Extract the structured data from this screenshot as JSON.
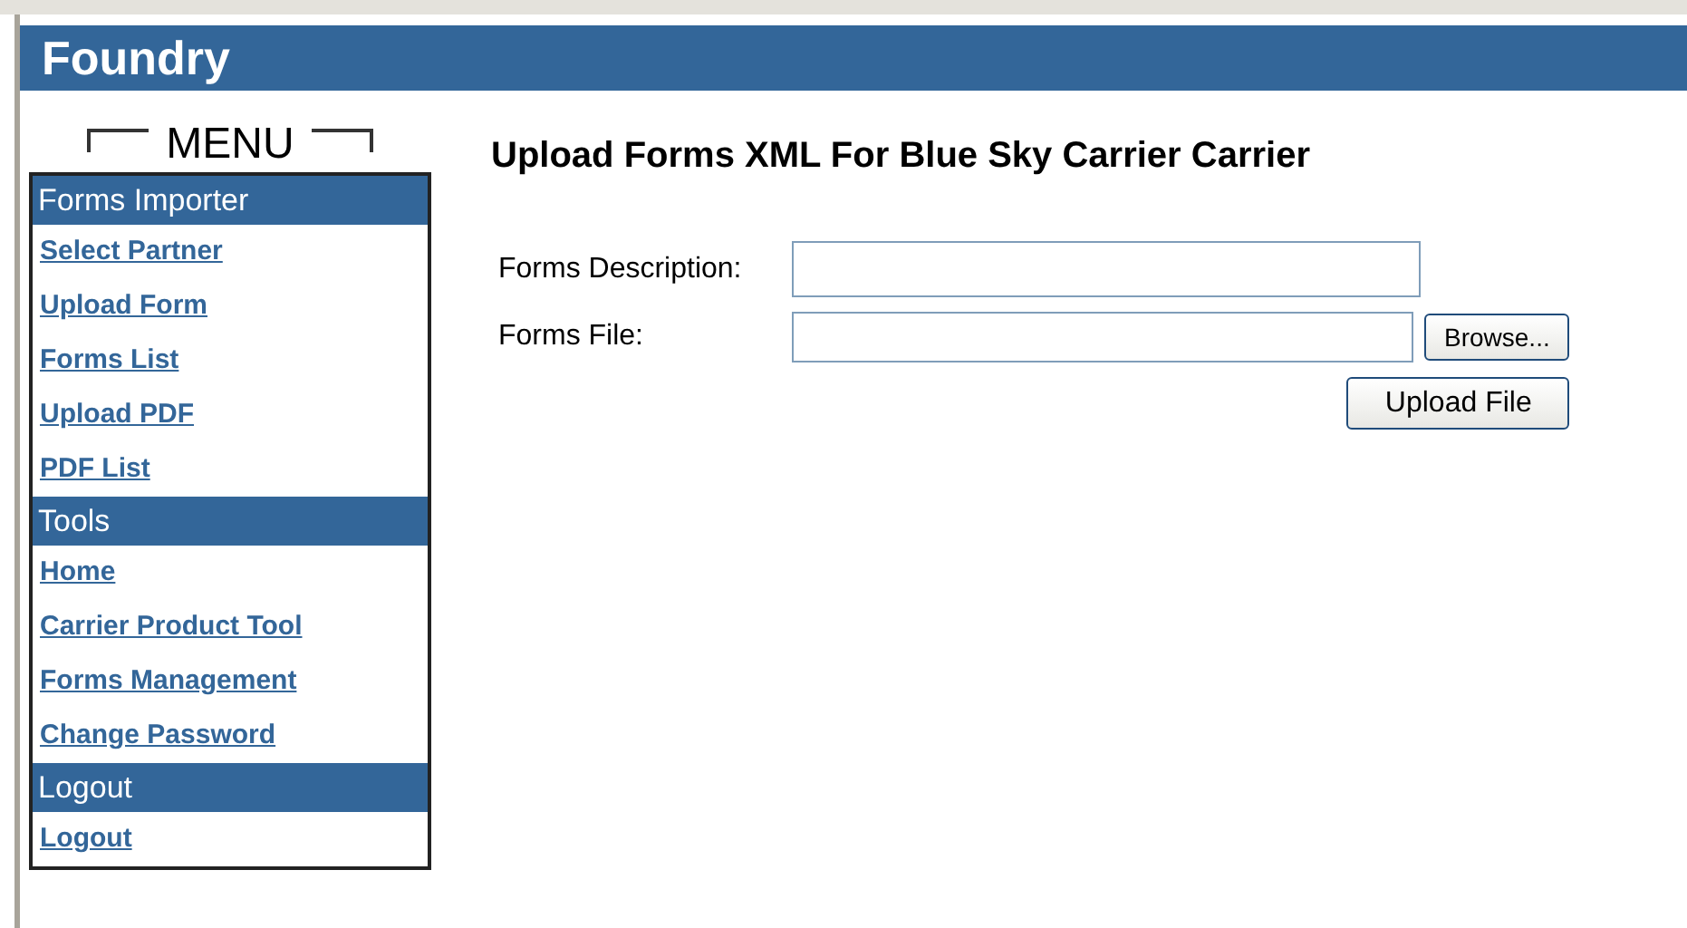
{
  "header": {
    "title": "Foundry"
  },
  "menu": {
    "title": "MENU",
    "sections": [
      {
        "heading": "Forms Importer",
        "links": [
          "Select Partner",
          "Upload Form",
          "Forms List",
          "Upload PDF",
          "PDF List"
        ]
      },
      {
        "heading": "Tools",
        "links": [
          "Home",
          "Carrier Product Tool",
          "Forms Management",
          "Change Password"
        ]
      },
      {
        "heading": "Logout",
        "links": [
          "Logout"
        ]
      }
    ]
  },
  "page": {
    "title": "Upload Forms XML For Blue Sky Carrier Carrier"
  },
  "form": {
    "fields": [
      {
        "label": "Forms Description:",
        "kind": "text"
      },
      {
        "label": "Forms File:",
        "kind": "file",
        "button": "Browse..."
      }
    ],
    "submit": "Upload File"
  }
}
